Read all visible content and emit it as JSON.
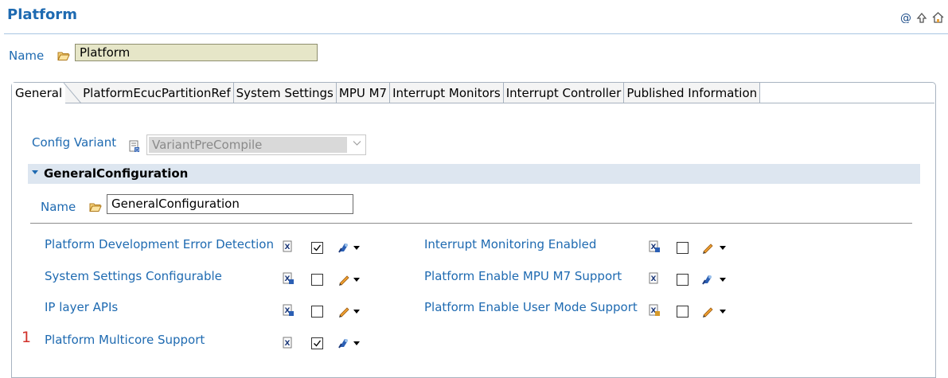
{
  "header": {
    "title": "Platform",
    "icons": [
      "at-icon",
      "up-arrow-icon",
      "home-icon"
    ]
  },
  "name_row": {
    "label": "Name",
    "value": "Platform"
  },
  "tabs": [
    {
      "label": "General",
      "active": true
    },
    {
      "label": "PlatformEcucPartitionRef"
    },
    {
      "label": "System Settings"
    },
    {
      "label": "MPU M7"
    },
    {
      "label": "Interrupt Monitors"
    },
    {
      "label": "Interrupt Controller"
    },
    {
      "label": "Published Information"
    }
  ],
  "config_variant": {
    "label": "Config Variant",
    "value": "VariantPreCompile"
  },
  "section": {
    "title": "GeneralConfiguration",
    "name_label": "Name",
    "name_value": "GeneralConfiguration"
  },
  "params_left": [
    {
      "label": "Platform Development Error Detection",
      "checked": true,
      "config_icon": "x-config-icon",
      "edit_icon": "calc-icon"
    },
    {
      "label": "System Settings Configurable",
      "checked": false,
      "config_icon": "xd-config-icon",
      "edit_icon": "pencil-icon"
    },
    {
      "label": "IP layer APIs",
      "checked": false,
      "config_icon": "xd-config-icon",
      "edit_icon": "pencil-icon"
    },
    {
      "label": "Platform Multicore Support",
      "checked": true,
      "config_icon": "x-config-icon",
      "edit_icon": "calc-icon"
    }
  ],
  "params_right": [
    {
      "label": "Interrupt Monitoring Enabled",
      "checked": false,
      "config_icon": "xd-config-icon",
      "edit_icon": "pencil-icon"
    },
    {
      "label": "Platform Enable MPU M7 Support",
      "checked": false,
      "config_icon": "x-config-icon",
      "edit_icon": "calc-icon"
    },
    {
      "label": "Platform Enable User Mode Support",
      "checked": false,
      "config_icon": "xd-config-icon",
      "edit_icon": "pencil-icon"
    }
  ],
  "marker": "1",
  "colors": {
    "link": "#1e6ab1",
    "section_bg": "#dde6f0",
    "name_field_bg": "#e6e6c8",
    "marker": "#d1312a"
  }
}
